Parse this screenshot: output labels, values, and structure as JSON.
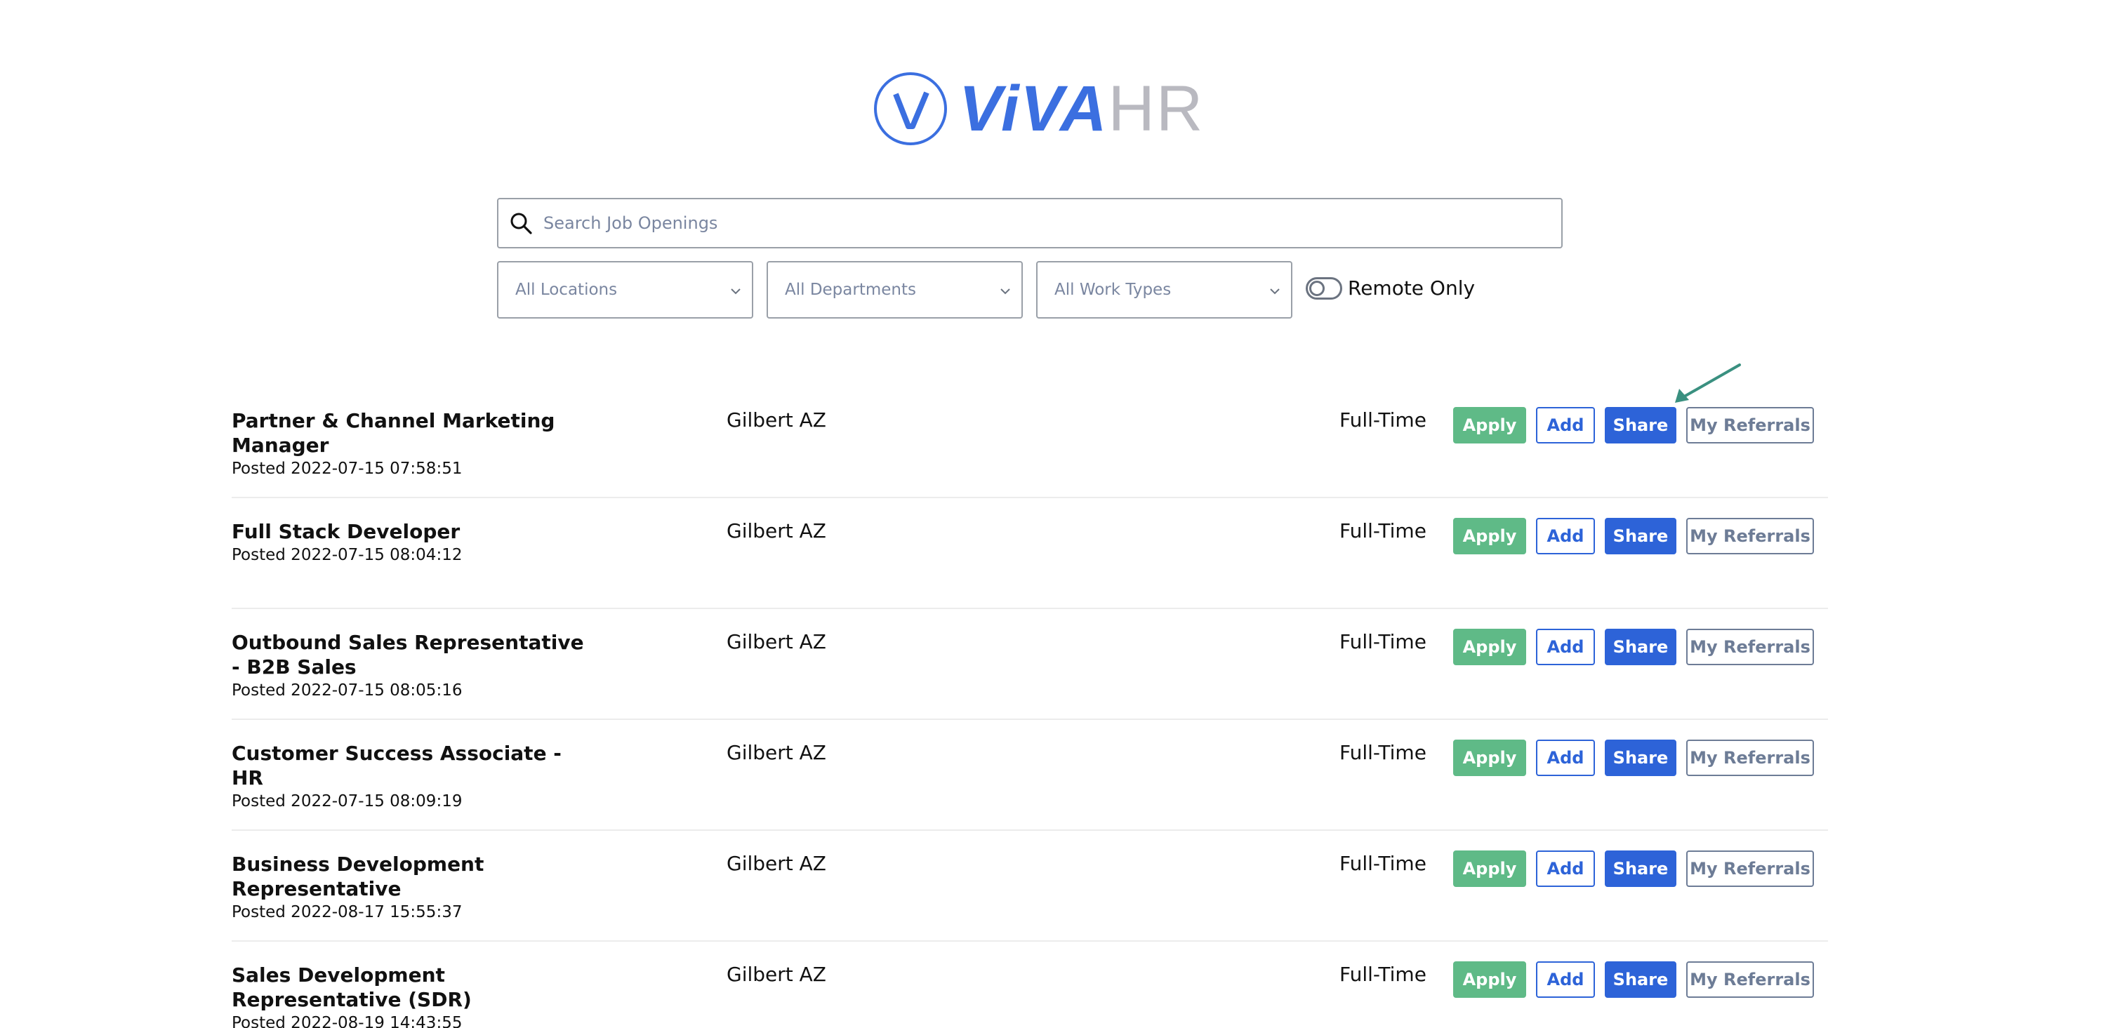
{
  "brand": {
    "name_part1": "ViVA",
    "name_part2": "HR",
    "mark_letter": "V",
    "color": "#3b6fe0"
  },
  "search": {
    "placeholder": "Search Job Openings",
    "value": ""
  },
  "filters": {
    "location": "All Locations",
    "department": "All Departments",
    "work_type": "All Work Types",
    "remote_label": "Remote Only",
    "remote_on": false
  },
  "buttons": {
    "apply": "Apply",
    "add": "Add",
    "share": "Share",
    "referrals": "My Referrals"
  },
  "colors": {
    "apply": "#5fba87",
    "primary": "#2d63d8",
    "muted": "#6d7c96",
    "arrow": "#3a9080"
  },
  "jobs": [
    {
      "title": "Partner & Channel Marketing Manager",
      "posted": "Posted 2022-07-15 07:58:51",
      "location": "Gilbert AZ",
      "type": "Full-Time"
    },
    {
      "title": "Full Stack Developer",
      "posted": "Posted 2022-07-15 08:04:12",
      "location": "Gilbert AZ",
      "type": "Full-Time"
    },
    {
      "title": "Outbound Sales Representative - B2B Sales",
      "posted": "Posted 2022-07-15 08:05:16",
      "location": "Gilbert AZ",
      "type": "Full-Time"
    },
    {
      "title": "Customer Success Associate - HR",
      "posted": "Posted 2022-07-15 08:09:19",
      "location": "Gilbert AZ",
      "type": "Full-Time"
    },
    {
      "title": "Business Development Representative",
      "posted": "Posted 2022-08-17 15:55:37",
      "location": "Gilbert AZ",
      "type": "Full-Time"
    },
    {
      "title": "Sales Development Representative (SDR)",
      "posted": "Posted 2022-08-19 14:43:55",
      "location": "Gilbert AZ",
      "type": "Full-Time"
    }
  ]
}
